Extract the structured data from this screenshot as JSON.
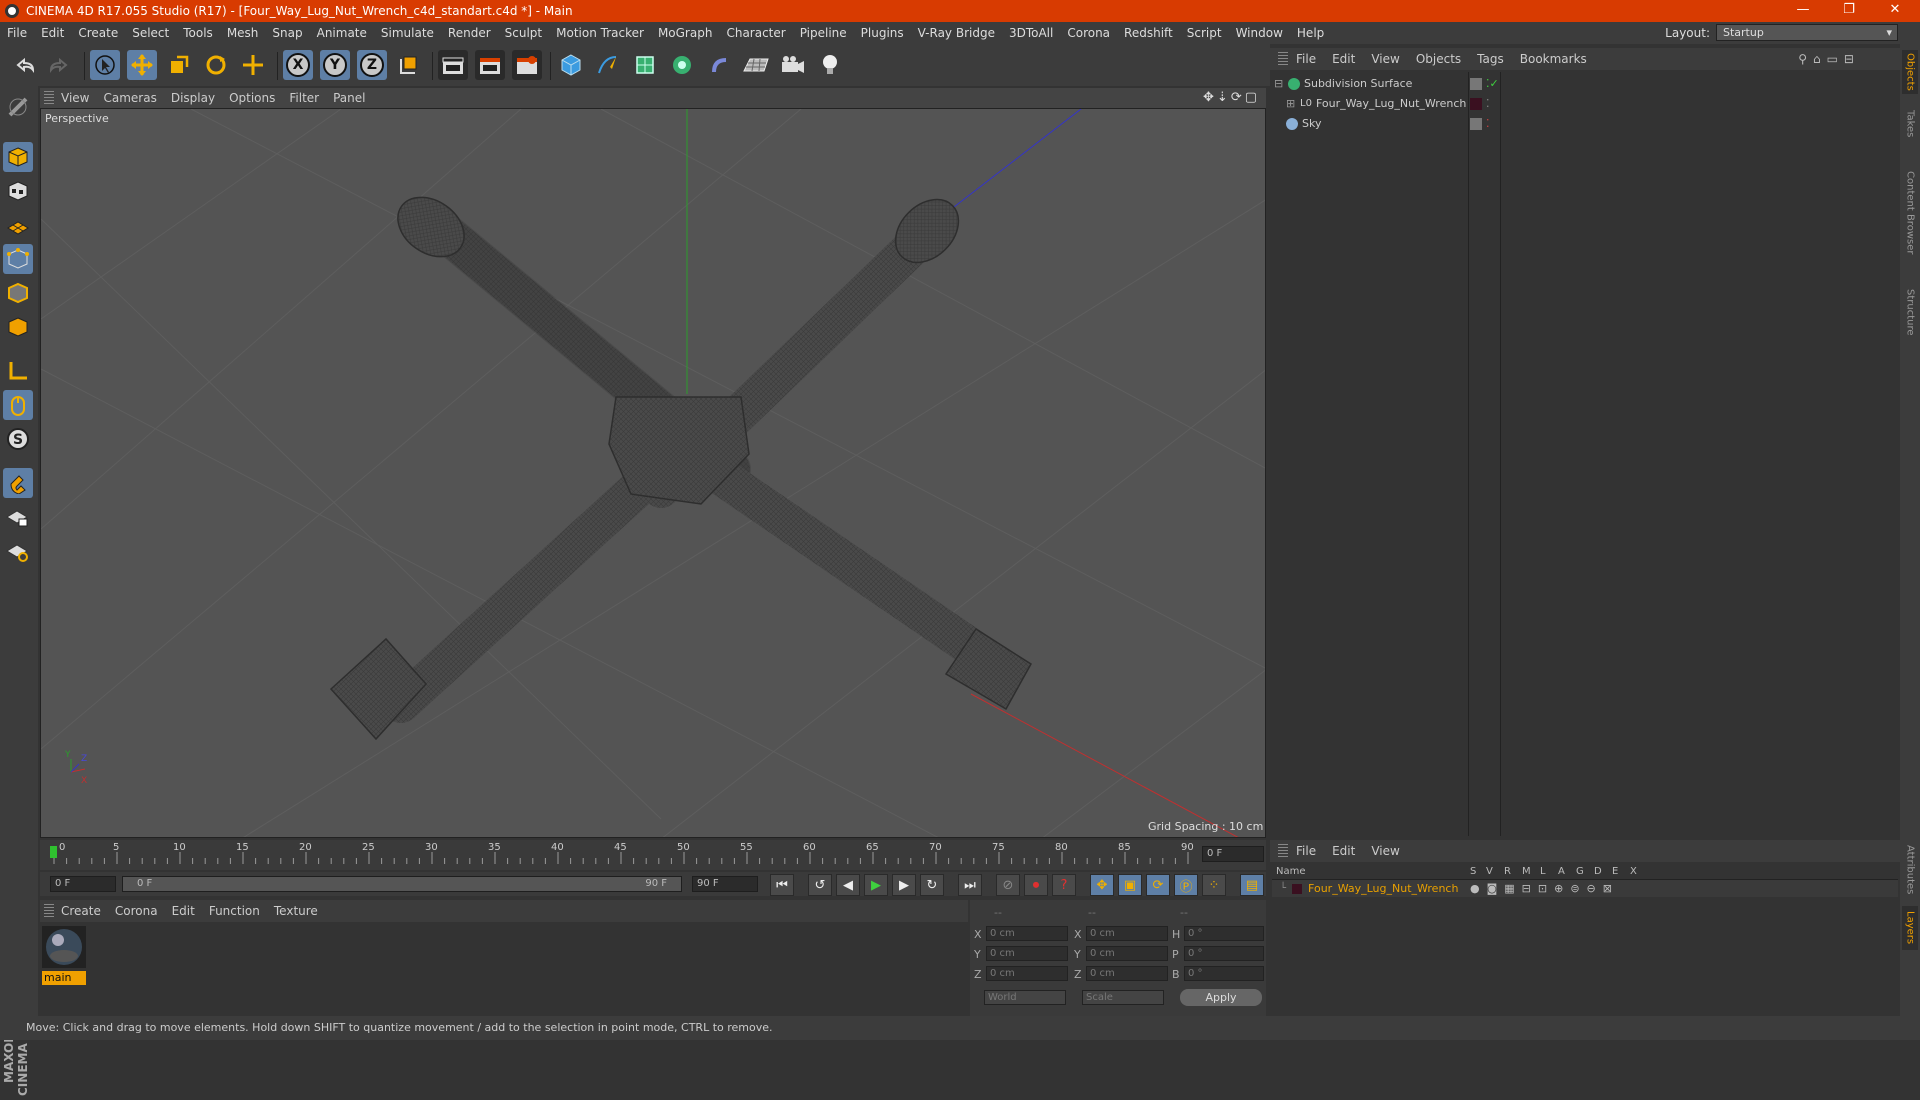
{
  "window": {
    "title": "CINEMA 4D R17.055 Studio (R17) - [Four_Way_Lug_Nut_Wrench_c4d_standart.c4d *] - Main",
    "minimize": "—",
    "restore": "❐",
    "close": "✕"
  },
  "menubar": [
    "File",
    "Edit",
    "Create",
    "Select",
    "Tools",
    "Mesh",
    "Snap",
    "Animate",
    "Simulate",
    "Render",
    "Sculpt",
    "Motion Tracker",
    "MoGraph",
    "Character",
    "Pipeline",
    "Plugins",
    "V-Ray Bridge",
    "3DToAll",
    "Corona",
    "Redshift",
    "Script",
    "Window",
    "Help"
  ],
  "layout": {
    "label": "Layout:",
    "value": "Startup"
  },
  "toolbar": {
    "undo_icon": "undo-icon",
    "redo_icon": "redo-icon",
    "x": "X",
    "y": "Y",
    "z": "Z"
  },
  "viewport": {
    "menu": [
      "View",
      "Cameras",
      "Display",
      "Options",
      "Filter",
      "Panel"
    ],
    "camera": "Perspective",
    "grid_spacing": "Grid Spacing : 10 cm",
    "axis_x": "X",
    "axis_y": "Y",
    "axis_z": "Z"
  },
  "timeline": {
    "ticks": [
      "0",
      "5",
      "10",
      "15",
      "20",
      "25",
      "30",
      "35",
      "40",
      "45",
      "50",
      "55",
      "60",
      "65",
      "70",
      "75",
      "80",
      "85",
      "90"
    ],
    "current_frame": "0 F",
    "start": "0 F",
    "range_start": "0 F",
    "range_end": "90 F",
    "end": "90 F"
  },
  "materials": {
    "menu": [
      "Create",
      "Corona",
      "Edit",
      "Function",
      "Texture"
    ],
    "items": [
      {
        "name": "main"
      }
    ]
  },
  "coordinates": {
    "headers": [
      "--",
      "--",
      "--"
    ],
    "rows": [
      {
        "a": "X",
        "av": "0 cm",
        "b": "X",
        "bv": "0 cm",
        "c": "H",
        "cv": "0 °"
      },
      {
        "a": "Y",
        "av": "0 cm",
        "b": "Y",
        "bv": "0 cm",
        "c": "P",
        "cv": "0 °"
      },
      {
        "a": "Z",
        "av": "0 cm",
        "b": "Z",
        "bv": "0 cm",
        "c": "B",
        "cv": "0 °"
      }
    ],
    "mode1": "World",
    "mode2": "Scale",
    "apply": "Apply"
  },
  "objects": {
    "menu": [
      "File",
      "Edit",
      "View",
      "Objects",
      "Tags",
      "Bookmarks"
    ],
    "items": [
      {
        "name": "Subdivision Surface",
        "color": "#ffffff"
      },
      {
        "name": "Four_Way_Lug_Nut_Wrench",
        "color": "#cccccc"
      },
      {
        "name": "Sky",
        "color": "#cccccc"
      }
    ]
  },
  "layers": {
    "menu": [
      "File",
      "Edit",
      "View"
    ],
    "columns": {
      "name": "Name",
      "flags": [
        "S",
        "V",
        "R",
        "M",
        "L",
        "A",
        "G",
        "D",
        "E",
        "X"
      ]
    },
    "items": [
      {
        "name": "Four_Way_Lug_Nut_Wrench",
        "color": "#e8a000"
      }
    ]
  },
  "side_tabs": [
    "Objects",
    "Takes",
    "Content Browser",
    "Structure",
    "Attributes",
    "Layers"
  ],
  "brand": "MAXON CINEMA 4D",
  "status": "Move: Click and drag to move elements. Hold down SHIFT to quantize movement / add to the selection in point mode, CTRL to remove."
}
